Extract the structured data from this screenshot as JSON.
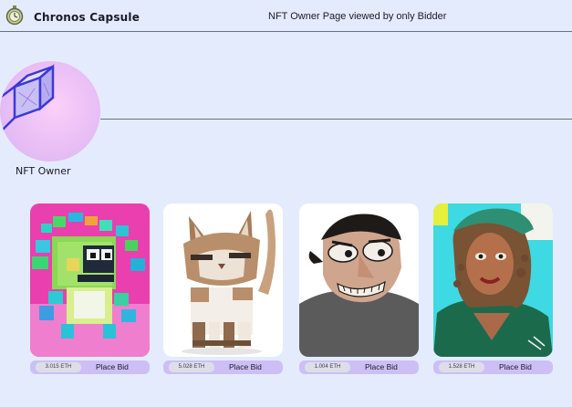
{
  "header": {
    "brand": "Chronos Capsule",
    "page_title": "NFT Owner Page viewed by only Bidder",
    "logo_icon": "pocket-watch-icon"
  },
  "owner": {
    "label": "NFT Owner",
    "avatar_icon": "cube-avatar"
  },
  "nfts": [
    {
      "price": "3.015 ETH",
      "action": "Place Bid",
      "art": "pixel-creature"
    },
    {
      "price": "5.028 ETH",
      "action": "Place Bid",
      "art": "cat"
    },
    {
      "price": "1.004 ETH",
      "action": "Place Bid",
      "art": "cartoon-man"
    },
    {
      "price": "1.528 ETH",
      "action": "Place Bid",
      "art": "woman-portrait"
    }
  ],
  "colors": {
    "background": "#e4ebfd",
    "bid_bar": "#cdbff6",
    "price_pill": "#dedee8"
  }
}
